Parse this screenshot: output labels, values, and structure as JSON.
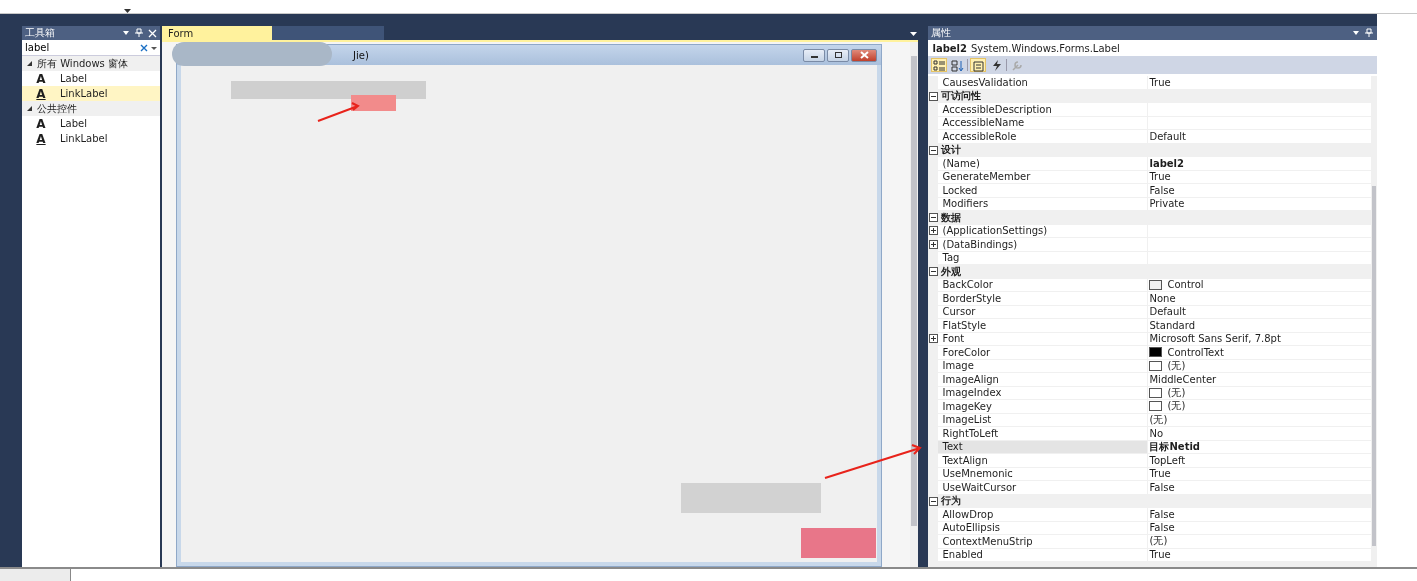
{
  "toolbox": {
    "title": "工具箱",
    "search": {
      "value": "label"
    },
    "groups": [
      {
        "label": "所有 Windows 窗体",
        "expanded": true,
        "items": [
          {
            "icon": "A",
            "label": "Label",
            "kind": "label",
            "selected": false
          },
          {
            "icon": "A",
            "label": "LinkLabel",
            "kind": "link",
            "selected": true
          }
        ]
      },
      {
        "label": "公共控件",
        "expanded": true,
        "items": [
          {
            "icon": "A",
            "label": "Label",
            "kind": "label",
            "selected": false
          },
          {
            "icon": "A",
            "label": "LinkLabel",
            "kind": "link",
            "selected": false
          }
        ]
      }
    ]
  },
  "designer": {
    "tabs": [
      {
        "label": "Form",
        "selected": true
      },
      {
        "selected": false
      }
    ],
    "form": {
      "title": "Jie)"
    }
  },
  "properties": {
    "title": "属性",
    "object_name": "label2",
    "object_type": "System.Windows.Forms.Label",
    "toolbar": [
      {
        "kind": "categorized",
        "selected": true,
        "disabled": false
      },
      {
        "kind": "alphabetical",
        "selected": false,
        "disabled": false
      },
      {
        "kind": "properties",
        "selected": true,
        "disabled": false
      },
      {
        "kind": "events",
        "selected": false,
        "disabled": false
      },
      {
        "kind": "pages",
        "selected": false,
        "disabled": true
      }
    ],
    "rows": [
      {
        "kind": "property",
        "name": "CausesValidation",
        "value": "True",
        "expandable": false,
        "modified": false,
        "selected": false
      },
      {
        "kind": "category",
        "name": "可访问性",
        "expanded": true
      },
      {
        "kind": "property",
        "name": "AccessibleDescription",
        "expandable": false,
        "selected": false
      },
      {
        "kind": "property",
        "name": "AccessibleName",
        "expandable": false,
        "selected": false
      },
      {
        "kind": "property",
        "name": "AccessibleRole",
        "value": "Default",
        "expandable": false,
        "modified": false,
        "selected": false
      },
      {
        "kind": "category",
        "name": "设计",
        "expanded": true
      },
      {
        "kind": "property",
        "name": "(Name)",
        "value": "label2",
        "expandable": false,
        "modified": true,
        "selected": false
      },
      {
        "kind": "property",
        "name": "GenerateMember",
        "value": "True",
        "expandable": false,
        "modified": false,
        "selected": false
      },
      {
        "kind": "property",
        "name": "Locked",
        "value": "False",
        "expandable": false,
        "modified": false,
        "selected": false
      },
      {
        "kind": "property",
        "name": "Modifiers",
        "value": "Private",
        "expandable": false,
        "modified": false,
        "selected": false
      },
      {
        "kind": "category",
        "name": "数据",
        "expanded": true
      },
      {
        "kind": "property",
        "name": "(ApplicationSettings)",
        "expandable": true,
        "selected": false
      },
      {
        "kind": "property",
        "name": "(DataBindings)",
        "expandable": true,
        "selected": false
      },
      {
        "kind": "property",
        "name": "Tag",
        "expandable": false,
        "selected": false
      },
      {
        "kind": "category",
        "name": "外观",
        "expanded": true
      },
      {
        "kind": "property",
        "name": "BackColor",
        "value": "Control",
        "color": "#f0f0f0",
        "expandable": false,
        "modified": false,
        "selected": false
      },
      {
        "kind": "property",
        "name": "BorderStyle",
        "value": "None",
        "expandable": false,
        "modified": false,
        "selected": false
      },
      {
        "kind": "property",
        "name": "Cursor",
        "value": "Default",
        "expandable": false,
        "modified": false,
        "selected": false
      },
      {
        "kind": "property",
        "name": "FlatStyle",
        "value": "Standard",
        "expandable": false,
        "modified": false,
        "selected": false
      },
      {
        "kind": "property",
        "name": "Font",
        "value": "Microsoft Sans Serif, 7.8pt",
        "expandable": true,
        "modified": false,
        "selected": false
      },
      {
        "kind": "property",
        "name": "ForeColor",
        "value": "ControlText",
        "color": "#000000",
        "expandable": false,
        "modified": false,
        "selected": false
      },
      {
        "kind": "property",
        "name": "Image",
        "value": "(无)",
        "color": "#ffffff",
        "expandable": false,
        "modified": false,
        "selected": false
      },
      {
        "kind": "property",
        "name": "ImageAlign",
        "value": "MiddleCenter",
        "expandable": false,
        "modified": false,
        "selected": false
      },
      {
        "kind": "property",
        "name": "ImageIndex",
        "value": "(无)",
        "color": "#ffffff",
        "expandable": false,
        "modified": false,
        "selected": false
      },
      {
        "kind": "property",
        "name": "ImageKey",
        "value": "(无)",
        "color": "#ffffff",
        "expandable": false,
        "modified": false,
        "selected": false
      },
      {
        "kind": "property",
        "name": "ImageList",
        "value": "(无)",
        "expandable": false,
        "modified": false,
        "selected": false
      },
      {
        "kind": "property",
        "name": "RightToLeft",
        "value": "No",
        "expandable": false,
        "modified": false,
        "selected": false
      },
      {
        "kind": "property",
        "name": "Text",
        "value": "目标Netid",
        "expandable": false,
        "modified": true,
        "selected": true
      },
      {
        "kind": "property",
        "name": "TextAlign",
        "value": "TopLeft",
        "expandable": false,
        "modified": false,
        "selected": false
      },
      {
        "kind": "property",
        "name": "UseMnemonic",
        "value": "True",
        "expandable": false,
        "modified": false,
        "selected": false
      },
      {
        "kind": "property",
        "name": "UseWaitCursor",
        "value": "False",
        "expandable": false,
        "modified": false,
        "selected": false
      },
      {
        "kind": "category",
        "name": "行为",
        "expanded": true
      },
      {
        "kind": "property",
        "name": "AllowDrop",
        "value": "False",
        "expandable": false,
        "modified": false,
        "selected": false
      },
      {
        "kind": "property",
        "name": "AutoEllipsis",
        "value": "False",
        "expandable": false,
        "modified": false,
        "selected": false
      },
      {
        "kind": "property",
        "name": "ContextMenuStrip",
        "value": "(无)",
        "expandable": false,
        "modified": false,
        "selected": false
      },
      {
        "kind": "property",
        "name": "Enabled",
        "value": "True",
        "expandable": false,
        "modified": false,
        "selected": false
      }
    ]
  }
}
